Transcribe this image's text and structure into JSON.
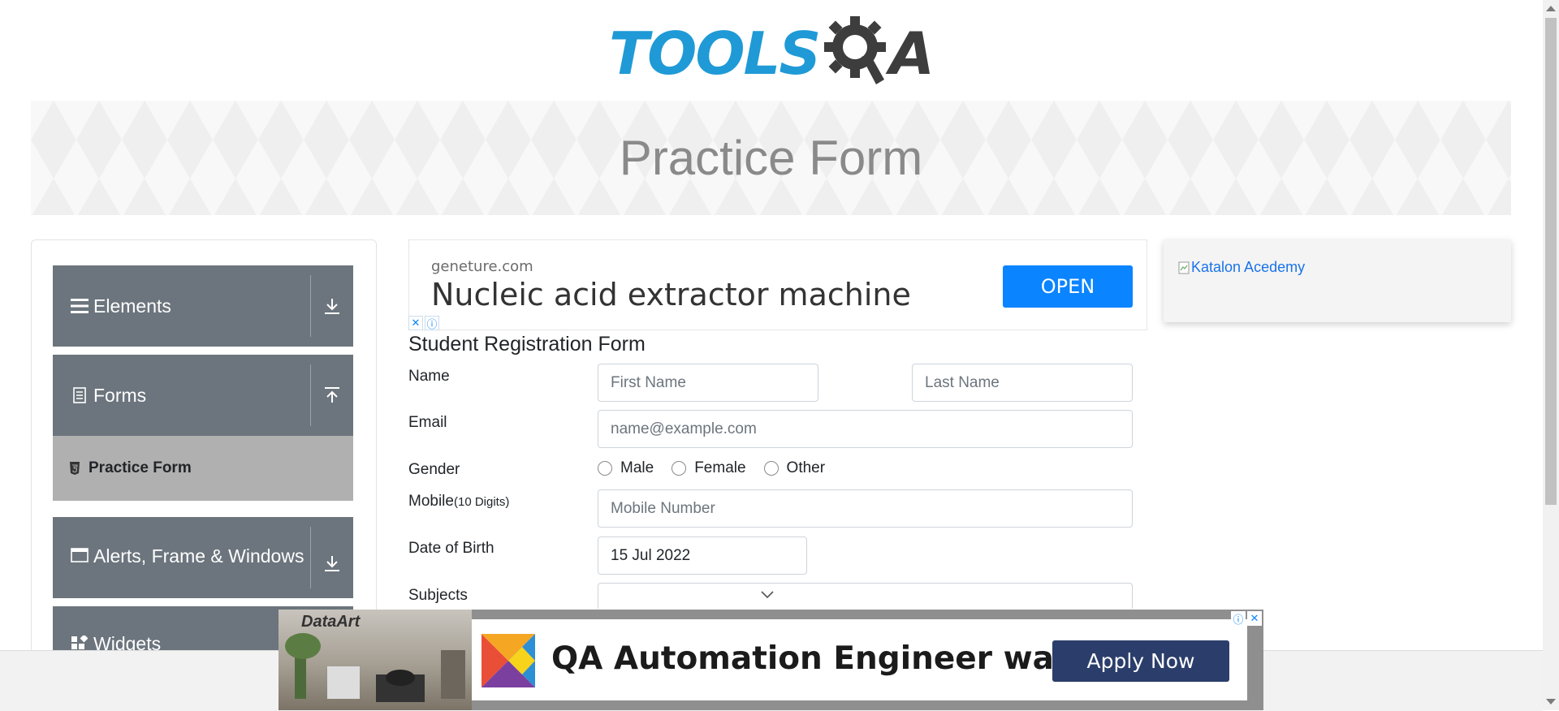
{
  "header": {
    "logo_text_tools": "TOOLS",
    "logo_text_a": "A"
  },
  "banner": {
    "title": "Practice Form"
  },
  "sidebar": {
    "groups": [
      {
        "label": "Elements",
        "icon": "hamburger-icon",
        "toggle_icon": "download-arrow-icon"
      },
      {
        "label": "Forms",
        "icon": "document-icon",
        "toggle_icon": "upload-arrow-icon"
      },
      {
        "label": "Alerts, Frame & Windows",
        "icon": "window-icon",
        "toggle_icon": "download-arrow-icon"
      },
      {
        "label": "Widgets",
        "icon": "widgets-icon",
        "toggle_icon": ""
      }
    ],
    "active_sub_item": {
      "label": "Practice Form",
      "icon": "html5-icon"
    }
  },
  "top_ad": {
    "domain": "geneture.com",
    "headline": "Nucleic acid extractor machine",
    "button": "OPEN"
  },
  "side_ad": {
    "alt_text": "Katalon Acedemy"
  },
  "form": {
    "title": "Student Registration Form",
    "name_label": "Name",
    "first_name_placeholder": "First Name",
    "last_name_placeholder": "Last Name",
    "email_label": "Email",
    "email_placeholder": "name@example.com",
    "gender_label": "Gender",
    "gender_options": [
      "Male",
      "Female",
      "Other"
    ],
    "mobile_label": "Mobile",
    "mobile_hint": "(10 Digits)",
    "mobile_placeholder": "Mobile Number",
    "dob_label": "Date of Birth",
    "dob_value": "15 Jul 2022",
    "subjects_label": "Subjects"
  },
  "bottom_ad": {
    "brand": "DataArt",
    "headline": "QA Automation Engineer wanted",
    "button": "Apply Now"
  },
  "colors": {
    "accent": "#1f9ad6",
    "sidebar_bg": "#6c757d",
    "open_button": "#0a84ff",
    "apply_button": "#2b3e6b"
  }
}
